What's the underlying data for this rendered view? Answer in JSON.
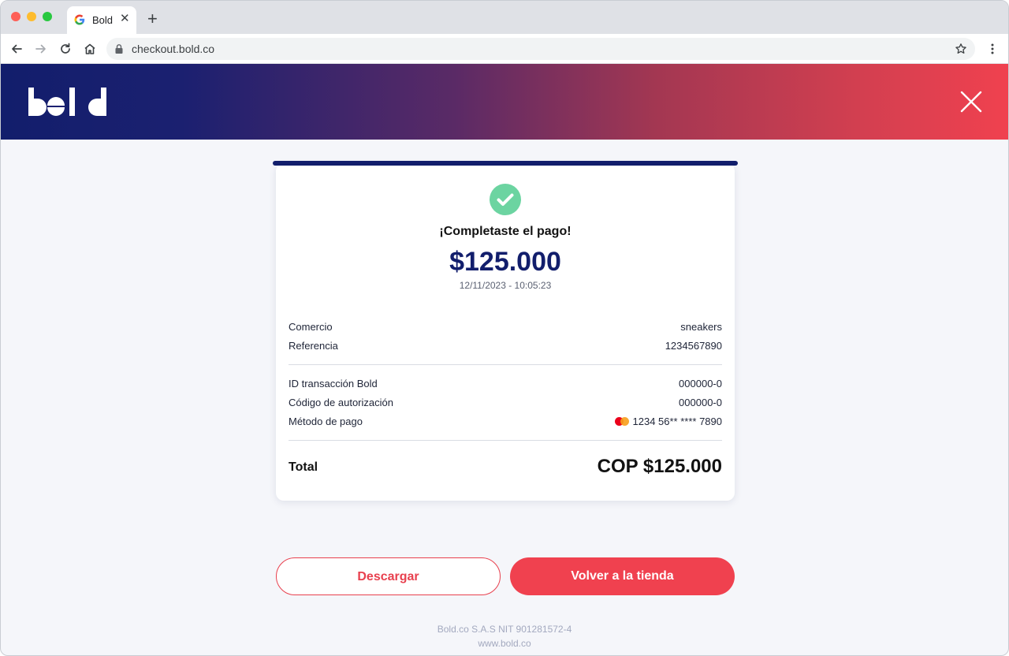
{
  "browser": {
    "tab_title": "Bold",
    "url": "checkout.bold.co"
  },
  "header": {
    "logo_text": "bold"
  },
  "receipt": {
    "title": "¡Completaste el pago!",
    "amount": "$125.000",
    "datetime": "12/11/2023 - 10:05:23",
    "rows": [
      {
        "label": "Comercio",
        "value": "sneakers"
      },
      {
        "label": "Referencia",
        "value": "1234567890"
      },
      {
        "label": "ID transacción Bold",
        "value": "000000-0"
      },
      {
        "label": "Código de autorización",
        "value": "000000-0"
      },
      {
        "label": "Método de pago",
        "value": "1234 56** **** 7890",
        "icon": "mastercard-icon"
      }
    ],
    "total_label": "Total",
    "total_value": "COP $125.000"
  },
  "actions": {
    "download_label": "Descargar",
    "back_label": "Volver a la tienda"
  },
  "footer": {
    "company": "Bold.co S.A.S NIT 901281572-4",
    "website": "www.bold.co"
  },
  "colors": {
    "brand_navy": "#121e6c",
    "brand_red": "#f0414f",
    "success_green": "#6cd4a1",
    "page_background": "#f5f6fa"
  }
}
